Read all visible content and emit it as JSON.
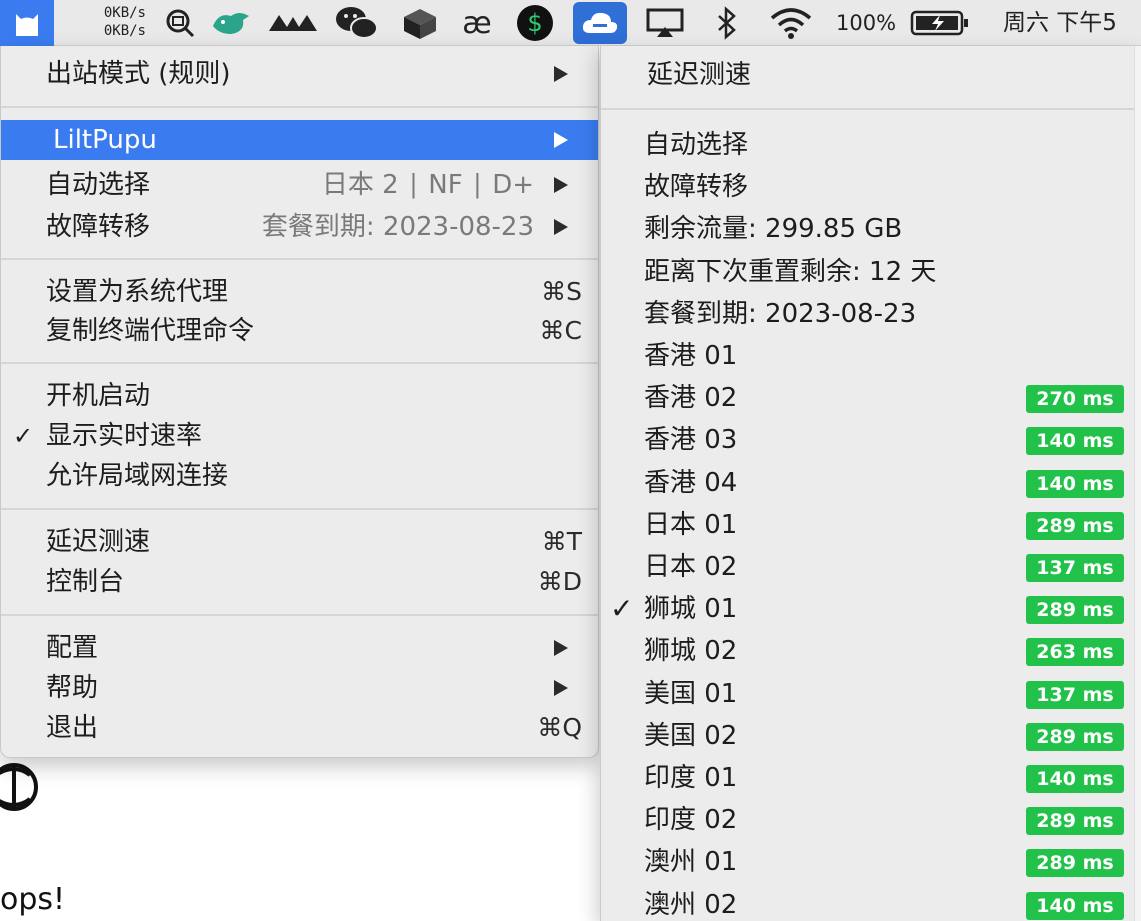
{
  "menubar": {
    "net_up": "0KB/s",
    "net_down": "0KB/s",
    "battery": "100%",
    "clock": "周六 下午5",
    "icons": [
      "cat-icon",
      "search-icon",
      "bird-icon",
      "glasses-icon",
      "wechat-icon",
      "box-icon",
      "ae-icon",
      "dollar-icon",
      "cloud-icon",
      "airplay-icon",
      "bluetooth-icon",
      "wifi-icon",
      "battery-icon"
    ]
  },
  "background": {
    "text": "ops!"
  },
  "main_menu": {
    "outbound_mode": "出站模式 (规则)",
    "group": "LiltPupu",
    "auto_select": {
      "label": "自动选择",
      "detail": "日本 2 ∣ NF ∣ D+"
    },
    "failover": {
      "label": "故障转移",
      "detail": "套餐到期: 2023-08-23"
    },
    "set_system_proxy": {
      "label": "设置为系统代理",
      "shortcut": "⌘S"
    },
    "copy_terminal": {
      "label": "复制终端代理命令",
      "shortcut": "⌘C"
    },
    "launch_at_login": {
      "label": "开机启动"
    },
    "show_speed": {
      "label": "显示实时速率",
      "checked": true
    },
    "allow_lan": {
      "label": "允许局域网连接"
    },
    "latency_test": {
      "label": "延迟测速",
      "shortcut": "⌘T"
    },
    "dashboard": {
      "label": "控制台",
      "shortcut": "⌘D"
    },
    "config": {
      "label": "配置"
    },
    "help": {
      "label": "帮助"
    },
    "quit": {
      "label": "退出",
      "shortcut": "⌘Q"
    }
  },
  "sub_menu": {
    "latency_test": "延迟测速",
    "items": [
      {
        "label": "自动选择",
        "latency": ""
      },
      {
        "label": "故障转移",
        "latency": ""
      },
      {
        "label": "剩余流量: 299.85 GB",
        "latency": ""
      },
      {
        "label": "距离下次重置剩余: 12 天",
        "latency": ""
      },
      {
        "label": "套餐到期: 2023-08-23",
        "latency": ""
      },
      {
        "label": "香港 01",
        "latency": ""
      },
      {
        "label": "香港 02",
        "latency": "270 ms"
      },
      {
        "label": "香港 03",
        "latency": "140 ms"
      },
      {
        "label": "香港 04",
        "latency": "140 ms"
      },
      {
        "label": "日本 01",
        "latency": "289 ms"
      },
      {
        "label": "日本 02",
        "latency": "137 ms"
      },
      {
        "label": "狮城 01",
        "latency": "289 ms",
        "checked": true
      },
      {
        "label": "狮城 02",
        "latency": "263 ms"
      },
      {
        "label": "美国 01",
        "latency": "137 ms"
      },
      {
        "label": "美国 02",
        "latency": "289 ms"
      },
      {
        "label": "印度 01",
        "latency": "140 ms"
      },
      {
        "label": "印度 02",
        "latency": "289 ms"
      },
      {
        "label": "澳州 01",
        "latency": "289 ms"
      },
      {
        "label": "澳州 02",
        "latency": "140 ms"
      }
    ],
    "latency_color": "#22c24a"
  },
  "colors": {
    "highlight": "#3a7cf0",
    "menu_bg": "#ececec",
    "accent_icon": "#2f6fd6"
  }
}
